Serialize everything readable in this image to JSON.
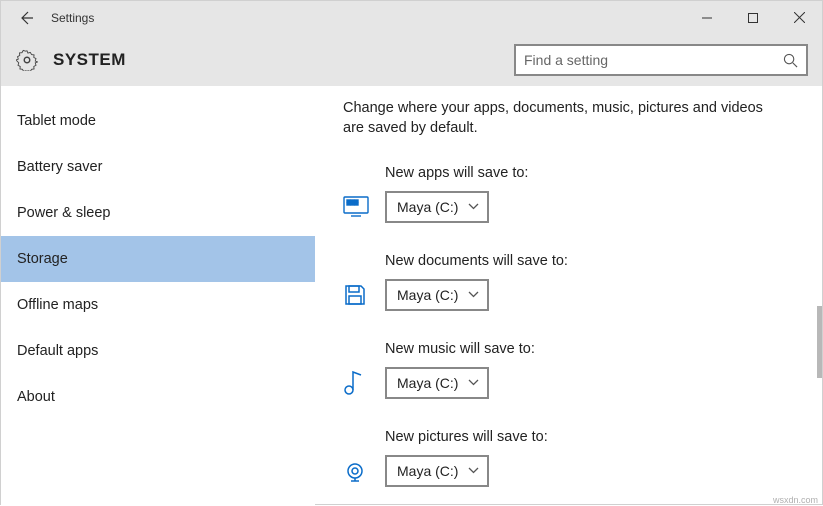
{
  "window": {
    "title": "Settings"
  },
  "header": {
    "title": "SYSTEM",
    "search_placeholder": "Find a setting"
  },
  "sidebar": {
    "items": [
      {
        "label": "Tablet mode",
        "selected": false
      },
      {
        "label": "Battery saver",
        "selected": false
      },
      {
        "label": "Power & sleep",
        "selected": false
      },
      {
        "label": "Storage",
        "selected": true
      },
      {
        "label": "Offline maps",
        "selected": false
      },
      {
        "label": "Default apps",
        "selected": false
      },
      {
        "label": "About",
        "selected": false
      }
    ]
  },
  "main": {
    "description": "Change where your apps, documents, music, pictures and videos are saved by default.",
    "settings": [
      {
        "label": "New apps will save to:",
        "value": "Maya (C:)",
        "icon": "monitor"
      },
      {
        "label": "New documents will save to:",
        "value": "Maya (C:)",
        "icon": "save"
      },
      {
        "label": "New music will save to:",
        "value": "Maya (C:)",
        "icon": "music"
      },
      {
        "label": "New pictures will save to:",
        "value": "Maya (C:)",
        "icon": "camera"
      }
    ]
  },
  "watermark": "wsxdn.com"
}
